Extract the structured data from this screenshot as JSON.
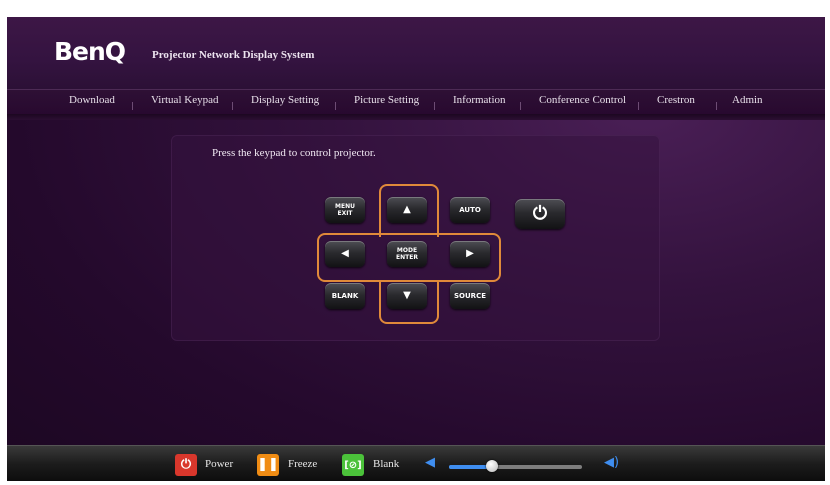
{
  "header": {
    "logo": "BenQ",
    "subtitle": "Projector Network Display System"
  },
  "nav": [
    "Download",
    "Virtual Keypad",
    "Display Setting",
    "Picture Setting",
    "Information",
    "Conference Control",
    "Crestron",
    "Admin"
  ],
  "keypad": {
    "instruction": "Press the keypad to control projector.",
    "menu_exit": [
      "MENU",
      "EXIT"
    ],
    "auto": "AUTO",
    "mode_enter": [
      "MODE",
      "ENTER"
    ],
    "blank": "BLANK",
    "source": "SOURCE",
    "up_icon": "up-arrow-icon",
    "down_icon": "down-arrow-icon",
    "left_icon": "left-arrow-icon",
    "right_icon": "right-arrow-icon",
    "power_icon": "power-icon",
    "ring_color": "#e08a3a"
  },
  "footer": {
    "power_label": "Power",
    "freeze_label": "Freeze",
    "blank_label": "Blank",
    "power_color": "#d9372c",
    "freeze_color": "#f08c14",
    "blank_color": "#4bc23a",
    "volume_level": 0.32,
    "volume_color": "#3f8ef0"
  }
}
